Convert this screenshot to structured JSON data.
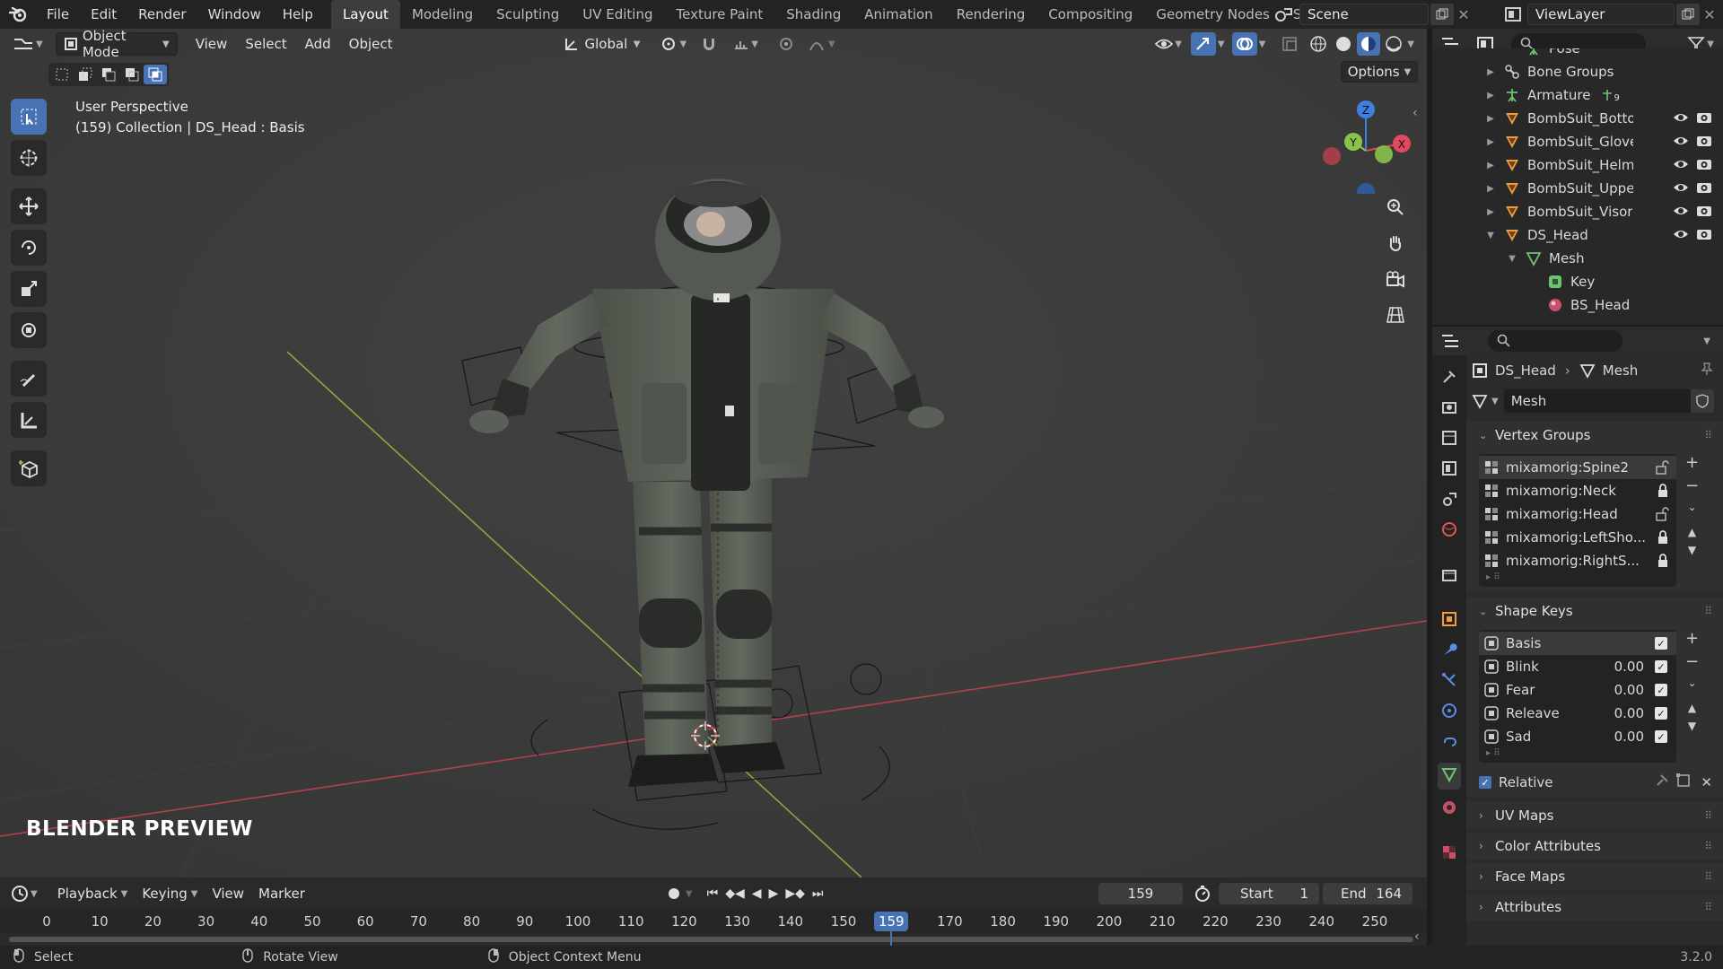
{
  "topbar": {
    "menus": [
      "File",
      "Edit",
      "Render",
      "Window",
      "Help"
    ],
    "workspaces": [
      "Layout",
      "Modeling",
      "Sculpting",
      "UV Editing",
      "Texture Paint",
      "Shading",
      "Animation",
      "Rendering",
      "Compositing",
      "Geometry Nodes",
      "Scripting"
    ],
    "active_workspace": "Layout",
    "scene": "Scene",
    "view_layer": "ViewLayer"
  },
  "viewport_header": {
    "mode": "Object Mode",
    "menus": [
      "View",
      "Select",
      "Add",
      "Object"
    ],
    "orientation": "Global",
    "options": "Options"
  },
  "viewport": {
    "view_name": "User Perspective",
    "collection_info": "(159) Collection | DS_Head : Basis",
    "watermark": "BLENDER PREVIEW",
    "gizmo": {
      "z": "Z",
      "y": "Y",
      "x": "X"
    }
  },
  "outliner": {
    "rows": [
      {
        "label": "Pose",
        "indent": 4,
        "icon": "pose-icon",
        "vis": false,
        "expand": ""
      },
      {
        "label": "Bone Groups",
        "indent": 3,
        "icon": "bone-groups-icon",
        "vis": false,
        "expand": "▶"
      },
      {
        "label": "Armature",
        "indent": 3,
        "icon": "armature-icon",
        "vis": false,
        "expand": "▶",
        "badge": "9"
      },
      {
        "label": "BombSuit_Botton",
        "indent": 3,
        "icon": "mesh-object-icon",
        "vis": true,
        "expand": "▶"
      },
      {
        "label": "BombSuit_Gloves",
        "indent": 3,
        "icon": "mesh-object-icon",
        "vis": true,
        "expand": "▶"
      },
      {
        "label": "BombSuit_Helme",
        "indent": 3,
        "icon": "mesh-object-icon",
        "vis": true,
        "expand": "▶"
      },
      {
        "label": "BombSuit_Upper",
        "indent": 3,
        "icon": "mesh-object-icon",
        "vis": true,
        "expand": "▶"
      },
      {
        "label": "BombSuit_Visor",
        "indent": 3,
        "icon": "mesh-object-icon",
        "vis": true,
        "expand": "▶"
      },
      {
        "label": "DS_Head",
        "indent": 3,
        "icon": "mesh-object-icon",
        "vis": true,
        "expand": "▼"
      },
      {
        "label": "Mesh",
        "indent": 4,
        "icon": "mesh-data-icon",
        "vis": false,
        "expand": "▼"
      },
      {
        "label": "Key",
        "indent": 5,
        "icon": "shape-key-icon",
        "vis": false,
        "expand": ""
      },
      {
        "label": "BS_Head",
        "indent": 5,
        "icon": "material-icon",
        "vis": false,
        "expand": ""
      }
    ]
  },
  "properties": {
    "breadcrumb": {
      "object": "DS_Head",
      "data": "Mesh"
    },
    "mesh_name": "Mesh",
    "vertex_groups": {
      "title": "Vertex Groups",
      "items": [
        {
          "name": "mixamorig:Spine2",
          "locked": false
        },
        {
          "name": "mixamorig:Neck",
          "locked": true
        },
        {
          "name": "mixamorig:Head",
          "locked": false
        },
        {
          "name": "mixamorig:LeftSho...",
          "locked": true
        },
        {
          "name": "mixamorig:RightS...",
          "locked": true
        }
      ]
    },
    "shape_keys": {
      "title": "Shape Keys",
      "items": [
        {
          "name": "Basis",
          "value": ""
        },
        {
          "name": "Blink",
          "value": "0.00"
        },
        {
          "name": "Fear",
          "value": "0.00"
        },
        {
          "name": "Releave",
          "value": "0.00"
        },
        {
          "name": "Sad",
          "value": "0.00"
        }
      ],
      "relative_label": "Relative"
    },
    "collapsed_panels": [
      "UV Maps",
      "Color Attributes",
      "Face Maps",
      "Attributes"
    ]
  },
  "timeline": {
    "menus": [
      "Playback",
      "Keying",
      "View",
      "Marker"
    ],
    "current_frame": "159",
    "start_label": "Start",
    "start": "1",
    "end_label": "End",
    "end": "164",
    "ruler_labels": [
      "0",
      "10",
      "20",
      "30",
      "40",
      "50",
      "60",
      "70",
      "80",
      "90",
      "100",
      "110",
      "120",
      "130",
      "140",
      "150",
      "159",
      "170",
      "180",
      "190",
      "200",
      "210",
      "220",
      "230",
      "240",
      "250"
    ]
  },
  "statusbar": {
    "select": "Select",
    "rotate": "Rotate View",
    "context": "Object Context Menu",
    "version": "3.2.0"
  },
  "colors": {
    "accent": "#4772b3",
    "viewport_bg": "#3c3c3c",
    "axis_x": "#e04a5f",
    "axis_y": "#8bc34a",
    "axis_z": "#3f7fe0"
  }
}
